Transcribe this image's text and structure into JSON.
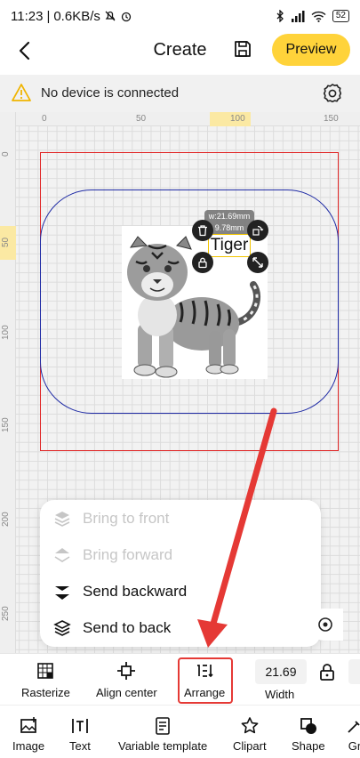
{
  "status_bar": {
    "time": "11:23",
    "network_speed": "0.6KB/s",
    "battery": "52"
  },
  "header": {
    "title": "Create",
    "preview_label": "Preview"
  },
  "notice": {
    "text": "No device is connected"
  },
  "rulers": {
    "top_labels": [
      "0",
      "50",
      "100",
      "150"
    ],
    "left_labels": [
      "0",
      "50",
      "100",
      "150",
      "200",
      "250"
    ]
  },
  "canvas": {
    "text_object": "Tiger",
    "dimension_tooltip": {
      "width": "w:21.69mm",
      "height": "9.78mm"
    }
  },
  "arrange_menu": {
    "items": [
      {
        "label": "Bring to front",
        "enabled": false
      },
      {
        "label": "Bring forward",
        "enabled": false
      },
      {
        "label": "Send backward",
        "enabled": true
      },
      {
        "label": "Send to back",
        "enabled": true
      }
    ]
  },
  "toolbar": {
    "rasterize": "Rasterize",
    "align_center": "Align center",
    "arrange": "Arrange",
    "width_value": "21.69",
    "width_label": "Width"
  },
  "bottom_nav": {
    "image": "Image",
    "text": "Text",
    "variable_template": "Variable template",
    "clipart": "Clipart",
    "shape": "Shape",
    "more": "Gr"
  },
  "colors": {
    "accent": "#ffd33a",
    "annotation_red": "#e53935",
    "frame_red": "#e02525",
    "frame_blue": "#1f2ba5"
  }
}
